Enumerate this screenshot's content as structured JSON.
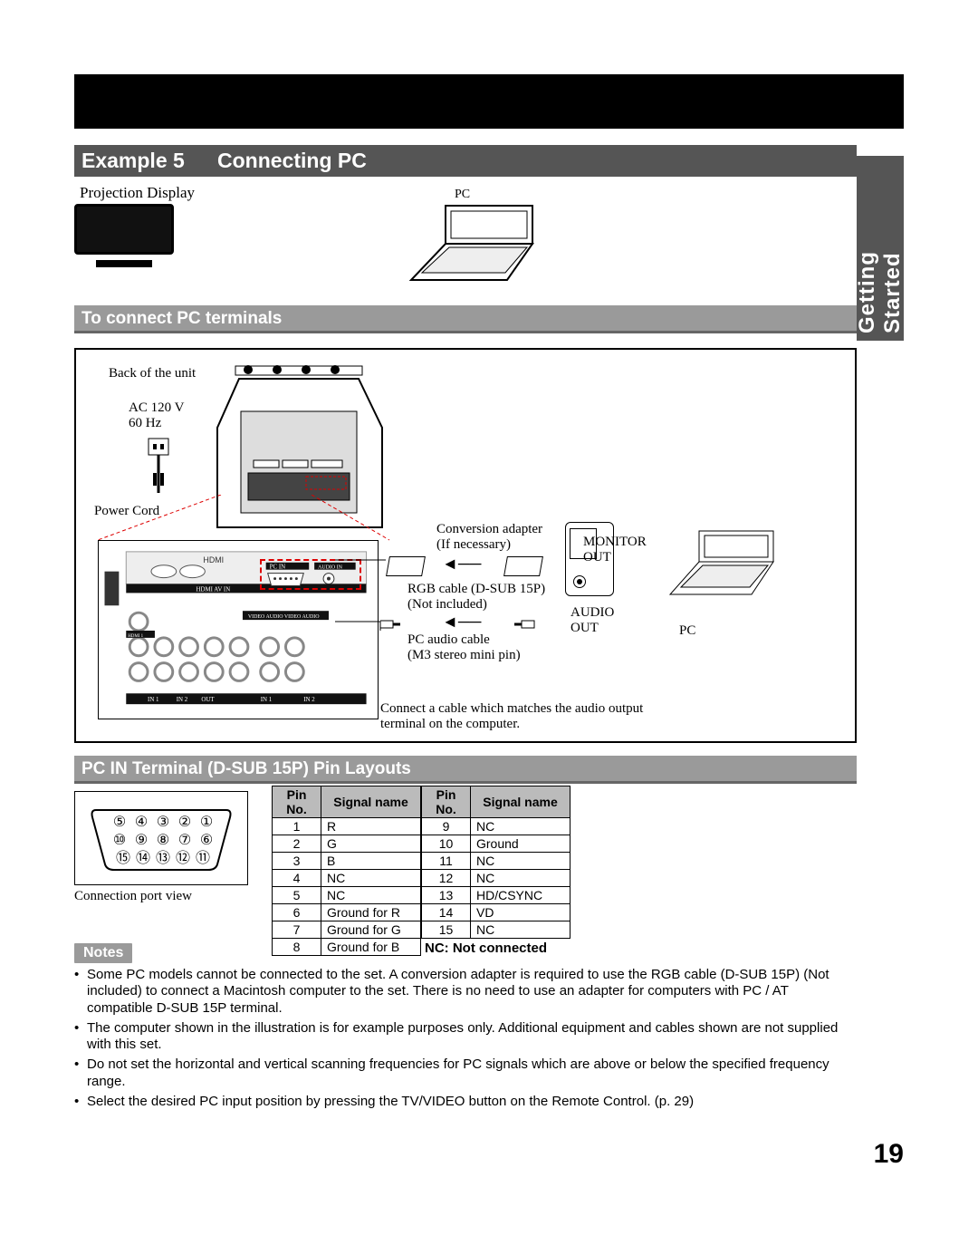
{
  "side_tab": "Getting Started",
  "title": {
    "example": "Example 5",
    "name": "Connecting PC"
  },
  "illus": {
    "projection": "Projection Display",
    "pc": "PC"
  },
  "sub1": "To connect PC terminals",
  "diagram_labels": {
    "back_of_unit": "Back of the unit",
    "ac": "AC 120 V\n60 Hz",
    "power_cord": "Power Cord",
    "conv_adapter": "Conversion adapter\n(If necessary)",
    "monitor_out": "MONITOR\nOUT",
    "rgb_cable": "RGB cable (D-SUB 15P)\n(Not included)",
    "audio_out": "AUDIO\nOUT",
    "pc_audio": "PC audio cable\n(M3 stereo mini pin)",
    "pc": "PC",
    "note": "Connect a cable which matches the audio output\nterminal on the computer."
  },
  "sub2": "PC IN Terminal (D-SUB 15P) Pin Layouts",
  "port_caption": "Connection port view",
  "port_pins": {
    "row1": [
      "⑤",
      "④",
      "③",
      "②",
      "①"
    ],
    "row2": [
      "⑩",
      "⑨",
      "⑧",
      "⑦",
      "⑥"
    ],
    "row3": [
      "⑮",
      "⑭",
      "⑬",
      "⑫",
      "⑪"
    ]
  },
  "pin_table_headers": {
    "pin": "Pin No.",
    "signal": "Signal name"
  },
  "pin_table_left": [
    {
      "n": "1",
      "s": "R"
    },
    {
      "n": "2",
      "s": "G"
    },
    {
      "n": "3",
      "s": "B"
    },
    {
      "n": "4",
      "s": "NC"
    },
    {
      "n": "5",
      "s": "NC"
    },
    {
      "n": "6",
      "s": "Ground for R"
    },
    {
      "n": "7",
      "s": "Ground for G"
    },
    {
      "n": "8",
      "s": "Ground for B"
    }
  ],
  "pin_table_right": [
    {
      "n": "9",
      "s": "NC"
    },
    {
      "n": "10",
      "s": "Ground"
    },
    {
      "n": "11",
      "s": "NC"
    },
    {
      "n": "12",
      "s": "NC"
    },
    {
      "n": "13",
      "s": "HD/CSYNC"
    },
    {
      "n": "14",
      "s": "VD"
    },
    {
      "n": "15",
      "s": "NC"
    }
  ],
  "nc_note": "NC: Not connected",
  "notes_label": "Notes",
  "notes": [
    "Some PC models cannot be connected to the set. A conversion adapter is required to use the RGB cable (D-SUB 15P) (Not included) to connect a Macintosh computer to the set. There is no need to use an adapter for computers with PC / AT compatible D-SUB 15P terminal.",
    "The computer shown in the illustration is for example purposes only. Additional equipment and cables shown are not supplied with this set.",
    "Do not set the horizontal and vertical scanning frequencies for PC signals which are above or below the specified frequency range.",
    "Select the desired PC input position by pressing the TV/VIDEO button on the Remote Control. (p. 29)"
  ],
  "page_number": "19"
}
